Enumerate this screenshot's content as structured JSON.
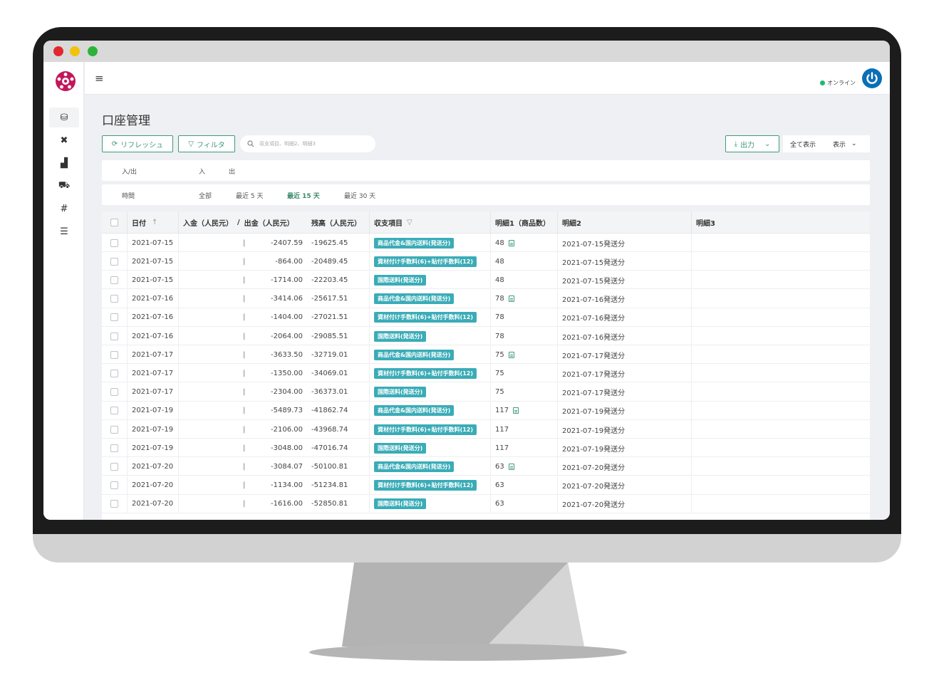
{
  "colors": {
    "accent": "#3f9a7c",
    "tag": "#3aacb7",
    "online": "#1fba6c",
    "power": "#0a6fb5"
  },
  "sidebar": {
    "items": [
      {
        "icon": "coins-icon",
        "glyph": "⛁",
        "active": true
      },
      {
        "icon": "close-icon",
        "glyph": "✖",
        "active": false
      },
      {
        "icon": "factory-icon",
        "glyph": "▟",
        "active": false
      },
      {
        "icon": "truck-icon",
        "glyph": "⛟",
        "active": false
      },
      {
        "icon": "hash-icon",
        "glyph": "#",
        "active": false
      },
      {
        "icon": "list-icon",
        "glyph": "☰",
        "active": false
      }
    ]
  },
  "header": {
    "menu_glyph": "≡",
    "status": "オンライン"
  },
  "page": {
    "title": "口座管理"
  },
  "toolbar": {
    "refresh_label": "リフレッシュ",
    "filter_label": "フィルタ",
    "search_placeholder": "収支項目、明細2、明細3",
    "export_label": "出力",
    "show_all_label": "全て表示",
    "display_label": "表示"
  },
  "filters": {
    "io": {
      "label": "入/出",
      "options": [
        "入",
        "出"
      ]
    },
    "period": {
      "label": "時間",
      "options": [
        "全部",
        "最近 5 天",
        "最近 15 天",
        "最近 30 天"
      ],
      "selected": "最近 15 天"
    }
  },
  "table": {
    "columns": {
      "date": "日付",
      "in": "入金（人民元）",
      "sep": "/",
      "out": "出金（人民元）",
      "balance": "残高（人民元）",
      "item": "収支項目",
      "detail1": "明細1（商品数）",
      "detail2": "明細2",
      "detail3": "明細3"
    },
    "rows": [
      {
        "date": "2021-07-15",
        "out": "-2407.59",
        "balance": "-19625.45",
        "item": "商品代金&国内送料(発送分)",
        "detail1": "48",
        "doc": true,
        "detail2": "2021-07-15発送分"
      },
      {
        "date": "2021-07-15",
        "out": "-864.00",
        "balance": "-20489.45",
        "item": "資材付け手数料(6)+貼付手数料(12)",
        "detail1": "48",
        "doc": false,
        "detail2": "2021-07-15発送分"
      },
      {
        "date": "2021-07-15",
        "out": "-1714.00",
        "balance": "-22203.45",
        "item": "国際送料(発送分)",
        "detail1": "48",
        "doc": false,
        "detail2": "2021-07-15発送分"
      },
      {
        "date": "2021-07-16",
        "out": "-3414.06",
        "balance": "-25617.51",
        "item": "商品代金&国内送料(発送分)",
        "detail1": "78",
        "doc": true,
        "detail2": "2021-07-16発送分"
      },
      {
        "date": "2021-07-16",
        "out": "-1404.00",
        "balance": "-27021.51",
        "item": "資材付け手数料(6)+貼付手数料(12)",
        "detail1": "78",
        "doc": false,
        "detail2": "2021-07-16発送分"
      },
      {
        "date": "2021-07-16",
        "out": "-2064.00",
        "balance": "-29085.51",
        "item": "国際送料(発送分)",
        "detail1": "78",
        "doc": false,
        "detail2": "2021-07-16発送分"
      },
      {
        "date": "2021-07-17",
        "out": "-3633.50",
        "balance": "-32719.01",
        "item": "商品代金&国内送料(発送分)",
        "detail1": "75",
        "doc": true,
        "detail2": "2021-07-17発送分"
      },
      {
        "date": "2021-07-17",
        "out": "-1350.00",
        "balance": "-34069.01",
        "item": "資材付け手数料(6)+貼付手数料(12)",
        "detail1": "75",
        "doc": false,
        "detail2": "2021-07-17発送分"
      },
      {
        "date": "2021-07-17",
        "out": "-2304.00",
        "balance": "-36373.01",
        "item": "国際送料(発送分)",
        "detail1": "75",
        "doc": false,
        "detail2": "2021-07-17発送分"
      },
      {
        "date": "2021-07-19",
        "out": "-5489.73",
        "balance": "-41862.74",
        "item": "商品代金&国内送料(発送分)",
        "detail1": "117",
        "doc": true,
        "detail2": "2021-07-19発送分"
      },
      {
        "date": "2021-07-19",
        "out": "-2106.00",
        "balance": "-43968.74",
        "item": "資材付け手数料(6)+貼付手数料(12)",
        "detail1": "117",
        "doc": false,
        "detail2": "2021-07-19発送分"
      },
      {
        "date": "2021-07-19",
        "out": "-3048.00",
        "balance": "-47016.74",
        "item": "国際送料(発送分)",
        "detail1": "117",
        "doc": false,
        "detail2": "2021-07-19発送分"
      },
      {
        "date": "2021-07-20",
        "out": "-3084.07",
        "balance": "-50100.81",
        "item": "商品代金&国内送料(発送分)",
        "detail1": "63",
        "doc": true,
        "detail2": "2021-07-20発送分"
      },
      {
        "date": "2021-07-20",
        "out": "-1134.00",
        "balance": "-51234.81",
        "item": "資材付け手数料(6)+貼付手数料(12)",
        "detail1": "63",
        "doc": false,
        "detail2": "2021-07-20発送分"
      },
      {
        "date": "2021-07-20",
        "out": "-1616.00",
        "balance": "-52850.81",
        "item": "国際送料(発送分)",
        "detail1": "63",
        "doc": false,
        "detail2": "2021-07-20発送分"
      }
    ]
  }
}
